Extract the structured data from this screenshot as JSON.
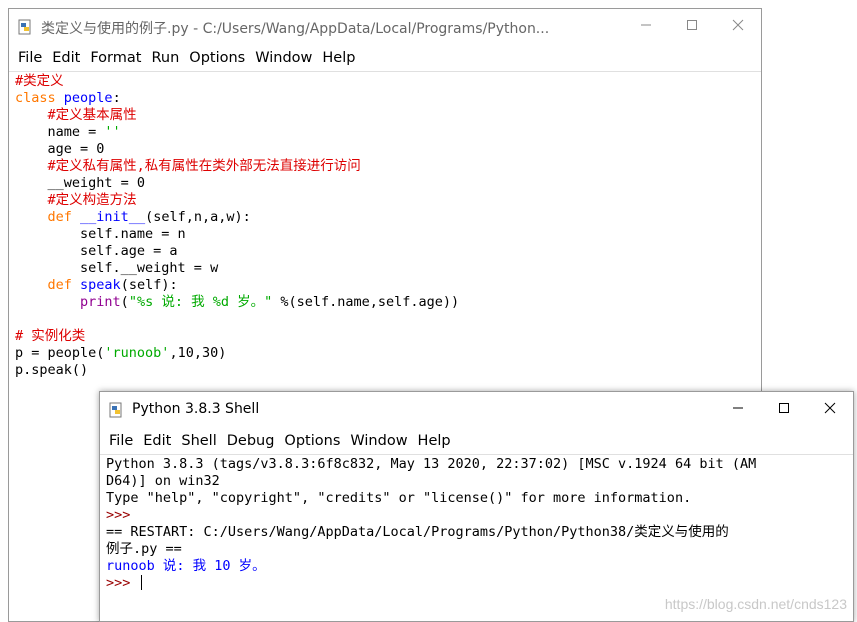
{
  "editor": {
    "title": "类定义与使用的例子.py - C:/Users/Wang/AppData/Local/Programs/Python...",
    "menu": [
      "File",
      "Edit",
      "Format",
      "Run",
      "Options",
      "Window",
      "Help"
    ],
    "lines": [
      [
        {
          "t": "#类定义",
          "c": "cm"
        }
      ],
      [
        {
          "t": "class",
          "c": "kw"
        },
        {
          "t": " ",
          "c": "nm"
        },
        {
          "t": "people",
          "c": "df"
        },
        {
          "t": ":",
          "c": "nm"
        }
      ],
      [
        {
          "t": "    ",
          "c": "nm"
        },
        {
          "t": "#定义基本属性",
          "c": "cm"
        }
      ],
      [
        {
          "t": "    name = ",
          "c": "nm"
        },
        {
          "t": "''",
          "c": "st"
        }
      ],
      [
        {
          "t": "    age = 0",
          "c": "nm"
        }
      ],
      [
        {
          "t": "    ",
          "c": "nm"
        },
        {
          "t": "#定义私有属性,私有属性在类外部无法直接进行访问",
          "c": "cm"
        }
      ],
      [
        {
          "t": "    __weight = 0",
          "c": "nm"
        }
      ],
      [
        {
          "t": "    ",
          "c": "nm"
        },
        {
          "t": "#定义构造方法",
          "c": "cm"
        }
      ],
      [
        {
          "t": "    ",
          "c": "nm"
        },
        {
          "t": "def",
          "c": "kw"
        },
        {
          "t": " ",
          "c": "nm"
        },
        {
          "t": "__init__",
          "c": "df"
        },
        {
          "t": "(self,n,a,w):",
          "c": "nm"
        }
      ],
      [
        {
          "t": "        self.name = n",
          "c": "nm"
        }
      ],
      [
        {
          "t": "        self.age = a",
          "c": "nm"
        }
      ],
      [
        {
          "t": "        self.__weight = w",
          "c": "nm"
        }
      ],
      [
        {
          "t": "    ",
          "c": "nm"
        },
        {
          "t": "def",
          "c": "kw"
        },
        {
          "t": " ",
          "c": "nm"
        },
        {
          "t": "speak",
          "c": "df"
        },
        {
          "t": "(self):",
          "c": "nm"
        }
      ],
      [
        {
          "t": "        ",
          "c": "nm"
        },
        {
          "t": "print",
          "c": "bi"
        },
        {
          "t": "(",
          "c": "nm"
        },
        {
          "t": "\"%s 说: 我 %d 岁。\"",
          "c": "st"
        },
        {
          "t": " %(self.name,self.age))",
          "c": "nm"
        }
      ],
      [
        {
          "t": "",
          "c": "nm"
        }
      ],
      [
        {
          "t": "# 实例化类",
          "c": "cm"
        }
      ],
      [
        {
          "t": "p = people(",
          "c": "nm"
        },
        {
          "t": "'runoob'",
          "c": "st"
        },
        {
          "t": ",10,30)",
          "c": "nm"
        }
      ],
      [
        {
          "t": "p.speak()",
          "c": "nm"
        }
      ]
    ]
  },
  "shell": {
    "title": "Python 3.8.3 Shell",
    "menu": [
      "File",
      "Edit",
      "Shell",
      "Debug",
      "Options",
      "Window",
      "Help"
    ],
    "lines": [
      [
        {
          "t": "Python 3.8.3 (tags/v3.8.3:6f8c832, May 13 2020, 22:37:02) [MSC v.1924 64 bit (AM",
          "c": "nm"
        }
      ],
      [
        {
          "t": "D64)] on win32",
          "c": "nm"
        }
      ],
      [
        {
          "t": "Type \"help\", \"copyright\", \"credits\" or \"license()\" for more information.",
          "c": "nm"
        }
      ],
      [
        {
          "t": ">>> ",
          "c": "prompt"
        }
      ],
      [
        {
          "t": "== RESTART: C:/Users/Wang/AppData/Local/Programs/Python/Python38/类定义与使用的",
          "c": "nm"
        }
      ],
      [
        {
          "t": "例子.py ==",
          "c": "nm"
        }
      ],
      [
        {
          "t": "runoob 说: 我 10 岁。",
          "c": "out"
        }
      ],
      [
        {
          "t": ">>> ",
          "c": "prompt"
        }
      ]
    ]
  },
  "watermark": "https://blog.csdn.net/cnds123",
  "colors": {
    "keyword": "#ff7700",
    "comment": "#dd0000",
    "string": "#00aa00",
    "builtin": "#900090",
    "definition": "#0000ff",
    "output": "#0000ff",
    "prompt": "#990000"
  }
}
